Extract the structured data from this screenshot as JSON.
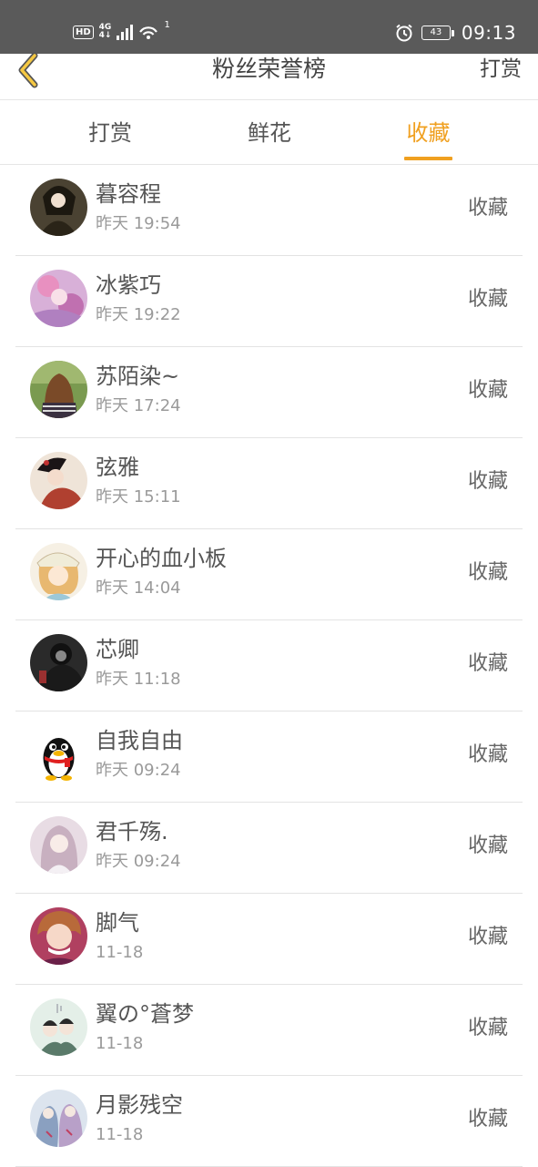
{
  "status_bar": {
    "hd": "HD",
    "network_top": "4G",
    "network_bottom": "4↓",
    "wifi_sup": "1",
    "battery": "43",
    "time": "09:13"
  },
  "header": {
    "title": "粉丝荣誉榜",
    "right_action": "打赏"
  },
  "tabs": [
    {
      "label": "打赏",
      "active": false
    },
    {
      "label": "鲜花",
      "active": false
    },
    {
      "label": "收藏",
      "active": true
    }
  ],
  "colors": {
    "accent": "#f0a020",
    "status_bar_bg": "#5a5a5a",
    "back_icon": "#f5c842"
  },
  "items": [
    {
      "name": "暮容程",
      "time": "昨天 19:54",
      "action": "收藏"
    },
    {
      "name": "冰紫巧",
      "time": "昨天 19:22",
      "action": "收藏"
    },
    {
      "name": "苏陌染~",
      "time": "昨天 17:24",
      "action": "收藏"
    },
    {
      "name": "弦雅",
      "time": "昨天 15:11",
      "action": "收藏"
    },
    {
      "name": "开心的血小板",
      "time": "昨天 14:04",
      "action": "收藏"
    },
    {
      "name": "芯卿",
      "time": "昨天 11:18",
      "action": "收藏"
    },
    {
      "name": "自我自由",
      "time": "昨天 09:24",
      "action": "收藏"
    },
    {
      "name": "君千殇.",
      "time": "昨天 09:24",
      "action": "收藏"
    },
    {
      "name": "脚气",
      "time": "11-18",
      "action": "收藏"
    },
    {
      "name": "翼の°蒼梦",
      "time": "11-18",
      "action": "收藏"
    },
    {
      "name": "月影残空",
      "time": "11-18",
      "action": "收藏"
    }
  ]
}
